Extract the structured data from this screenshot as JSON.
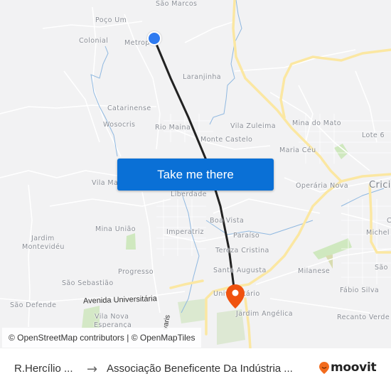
{
  "map": {
    "places": [
      {
        "id": "sao-marcos",
        "label": "São Marcos"
      },
      {
        "id": "poco-um",
        "label": "Poço Um"
      },
      {
        "id": "colonial",
        "label": "Colonial"
      },
      {
        "id": "metropol",
        "label": "Metrop"
      },
      {
        "id": "laranjinha",
        "label": "Laranjinha"
      },
      {
        "id": "catarinense",
        "label": "Catarinense"
      },
      {
        "id": "wosocris",
        "label": "Wosocris"
      },
      {
        "id": "rio-maina",
        "label": "Rio Maina"
      },
      {
        "id": "vila-zuleima",
        "label": "Vila Zuleima"
      },
      {
        "id": "mina-do-mato",
        "label": "Mina do Mato"
      },
      {
        "id": "lote-6",
        "label": "Lote 6"
      },
      {
        "id": "monte-castelo",
        "label": "Monte Castelo"
      },
      {
        "id": "maria-ceu",
        "label": "Maria Céu"
      },
      {
        "id": "vila-ma",
        "label": "Vila Ma"
      },
      {
        "id": "liberdade",
        "label": "Liberdade"
      },
      {
        "id": "operaria-nova",
        "label": "Operária Nova"
      },
      {
        "id": "criciuma",
        "label": "Cricium"
      },
      {
        "id": "mina-uniao",
        "label": "Mina União"
      },
      {
        "id": "jardim-montevideu-1",
        "label": "Jardim"
      },
      {
        "id": "jardim-montevideu-2",
        "label": "Montevidéu"
      },
      {
        "id": "imperatriz",
        "label": "Imperatriz"
      },
      {
        "id": "boa-vista",
        "label": "Boa Vista"
      },
      {
        "id": "paraiso",
        "label": "Paraíso"
      },
      {
        "id": "michel",
        "label": "Michel"
      },
      {
        "id": "c-label",
        "label": "C"
      },
      {
        "id": "tereza-cristina",
        "label": "Tereza Cristina"
      },
      {
        "id": "progresso",
        "label": "Progresso"
      },
      {
        "id": "santa-augusta",
        "label": "Santa Augusta"
      },
      {
        "id": "milanese",
        "label": "Milanese"
      },
      {
        "id": "sao-right",
        "label": "São"
      },
      {
        "id": "sao-sebastiao",
        "label": "São Sebastião"
      },
      {
        "id": "universitario",
        "label": "Universitário"
      },
      {
        "id": "fabio-silva",
        "label": "Fábio Silva"
      },
      {
        "id": "sao-defende",
        "label": "São Defende"
      },
      {
        "id": "vila-nova-1",
        "label": "Vila Nova"
      },
      {
        "id": "vila-nova-2",
        "label": "Esperança"
      },
      {
        "id": "jardim-angelica",
        "label": "Jardim Angélica"
      },
      {
        "id": "recanto-verde",
        "label": "Recanto Verde"
      }
    ],
    "streets": [
      {
        "id": "avenida-universitaria",
        "label": "Avenida Universitária"
      },
      {
        "id": "varis",
        "label": "varis"
      }
    ],
    "cta_label": "Take me there",
    "attribution": "© OpenStreetMap contributors | © OpenMapTiles",
    "colors": {
      "route": "#222222",
      "origin": "#2e7af0",
      "destination": "#f0520f",
      "cta": "#0a70d6",
      "highway": "#fbe7a2",
      "water": "#8fb8e0",
      "park": "#cfe8bf"
    }
  },
  "footer": {
    "from": "R.Hercílio ...",
    "arrow": "→",
    "to": "Associação Beneficente Da Indústria ...",
    "brand": "moovit",
    "brand_color": "#f26b1d"
  }
}
